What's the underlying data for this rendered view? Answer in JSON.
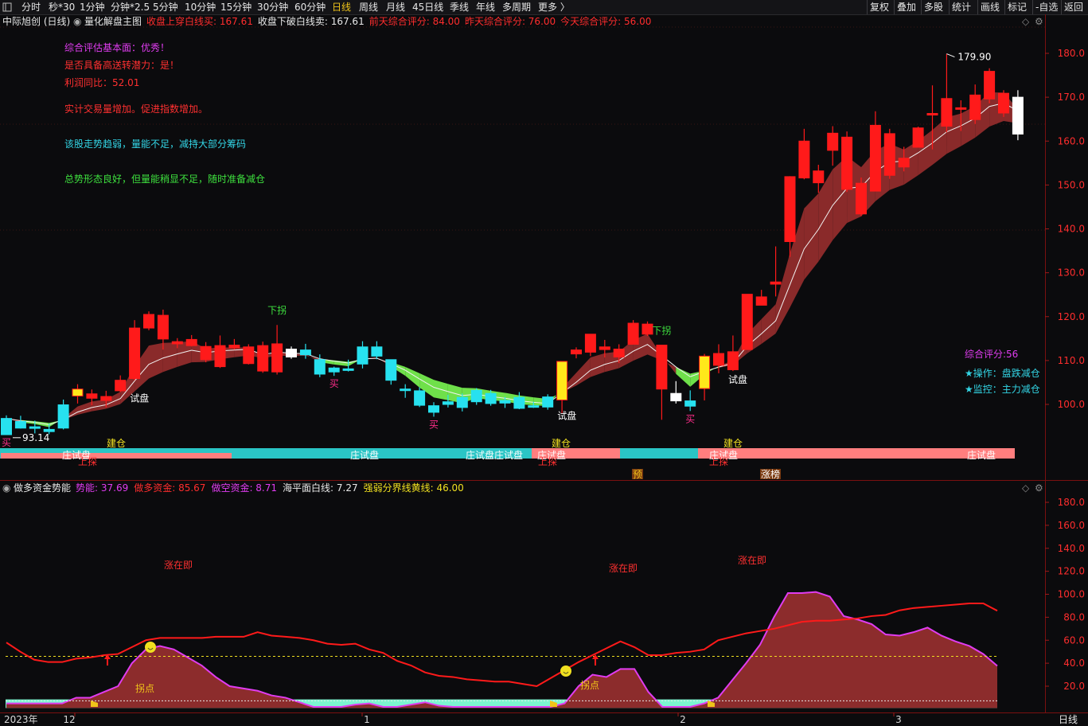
{
  "toolbar": {
    "periods": [
      "分时",
      "秒*30",
      "1分钟",
      "分钟*2.5",
      "5分钟",
      "10分钟",
      "15分钟",
      "30分钟",
      "60分钟",
      "日线",
      "周线",
      "月线",
      "45日线",
      "季线",
      "年线",
      "多周期",
      "更多 〉"
    ],
    "active": "日线",
    "right": [
      "复权",
      "叠加",
      "多股",
      "统计",
      "画线",
      "标记",
      "-自选",
      "返回"
    ]
  },
  "main_header": {
    "stock": "中际旭创 (日线)",
    "indicator": "量化解盘主图",
    "items": [
      {
        "label": "收盘上穿白线买:",
        "value": "167.61",
        "color": "#ff2d2d"
      },
      {
        "label": "收盘下破白线卖:",
        "value": "167.61",
        "color": "#e8e8e8"
      },
      {
        "label": "前天综合评分:",
        "value": "84.00",
        "color": "#ff2d2d"
      },
      {
        "label": "昨天综合评分:",
        "value": "76.00",
        "color": "#ff2d2d"
      },
      {
        "label": "今天综合评分:",
        "value": "56.00",
        "color": "#ff2d2d"
      }
    ]
  },
  "notes": [
    {
      "text": "综合评估基本面：优秀！",
      "color": "#e03cf0"
    },
    {
      "text": "是否具备高送转潜力：是！",
      "color": "#ff3030"
    },
    {
      "text": "利润同比：52.01",
      "color": "#ff3030"
    },
    {
      "text": "实计交易量增加。促进指数增加。",
      "color": "#ff3030"
    },
    {
      "text": "该股走势趋弱，量能不足，减持大部分筹码",
      "color": "#33d6e6"
    },
    {
      "text": "总势形态良好，但量能稍显不足，随时准备减仓",
      "color": "#3ee03e"
    }
  ],
  "right_notes": [
    {
      "text": "综合评分:56",
      "color": "#e03cf0"
    },
    {
      "text": "★操作：盘跌减仓",
      "color": "#33d6e6"
    },
    {
      "text": "★监控：主力减仓",
      "color": "#33d6e6"
    }
  ],
  "chart_data": [
    {
      "type": "candlestick",
      "title": "量化解盘主图",
      "y_ticks": [
        100.0,
        110.0,
        120.0,
        130.0,
        140.0,
        150.0,
        160.0,
        170.0,
        180.0
      ],
      "ylim": [
        88,
        186
      ],
      "high_label": "179.90",
      "low_label": "93.14",
      "candles": [
        {
          "o": 93.1,
          "h": 97.5,
          "l": 93.1,
          "c": 96.8,
          "color": "cyan"
        },
        {
          "o": 96.1,
          "h": 97.4,
          "l": 94.5,
          "c": 94.6,
          "color": "cyan"
        },
        {
          "o": 94.8,
          "h": 96.3,
          "l": 93.4,
          "c": 94.9,
          "color": "cyan"
        },
        {
          "o": 94.3,
          "h": 95.6,
          "l": 93.2,
          "c": 93.8,
          "color": "cyan"
        },
        {
          "o": 94.6,
          "h": 101.1,
          "l": 94.3,
          "c": 99.9,
          "color": "cyan"
        },
        {
          "o": 101.9,
          "h": 104.6,
          "l": 100.2,
          "c": 103.5,
          "color": "yellow"
        },
        {
          "o": 101.4,
          "h": 103.4,
          "l": 99.8,
          "c": 102.4,
          "color": "red"
        },
        {
          "o": 100.9,
          "h": 103.1,
          "l": 99.3,
          "c": 101.8,
          "color": "red"
        },
        {
          "o": 103.1,
          "h": 106.6,
          "l": 102.8,
          "c": 105.5,
          "color": "red"
        },
        {
          "o": 105.9,
          "h": 119.2,
          "l": 105.5,
          "c": 117.4,
          "color": "red"
        },
        {
          "o": 117.4,
          "h": 121.2,
          "l": 116.9,
          "c": 120.5,
          "color": "red"
        },
        {
          "o": 120.3,
          "h": 121.6,
          "l": 112.5,
          "c": 114.9,
          "color": "red"
        },
        {
          "o": 113.8,
          "h": 115.1,
          "l": 112.8,
          "c": 114.3,
          "color": "red"
        },
        {
          "o": 113.4,
          "h": 115.8,
          "l": 113.2,
          "c": 114.8,
          "color": "red"
        },
        {
          "o": 113.2,
          "h": 114.2,
          "l": 109.6,
          "c": 110.2,
          "color": "red"
        },
        {
          "o": 108.6,
          "h": 115.7,
          "l": 108.3,
          "c": 113.4,
          "color": "red"
        },
        {
          "o": 113.5,
          "h": 114.9,
          "l": 112.5,
          "c": 112.9,
          "color": "red"
        },
        {
          "o": 109.3,
          "h": 113.7,
          "l": 109.1,
          "c": 113.1,
          "color": "red"
        },
        {
          "o": 113.4,
          "h": 114.3,
          "l": 107.2,
          "c": 107.6,
          "color": "red"
        },
        {
          "o": 107.4,
          "h": 118.1,
          "l": 106.8,
          "c": 113.8,
          "color": "red"
        },
        {
          "o": 112.6,
          "h": 113.2,
          "l": 110.4,
          "c": 110.8,
          "color": "white"
        },
        {
          "o": 112.4,
          "h": 113.8,
          "l": 110.4,
          "c": 111.3,
          "color": "cyan"
        },
        {
          "o": 110.2,
          "h": 111.4,
          "l": 106.2,
          "c": 106.9,
          "color": "cyan"
        },
        {
          "o": 107.4,
          "h": 108.6,
          "l": 106.5,
          "c": 108.3,
          "color": "cyan"
        },
        {
          "o": 108.1,
          "h": 110.2,
          "l": 107.5,
          "c": 108.1,
          "color": "cyan"
        },
        {
          "o": 109.2,
          "h": 114.4,
          "l": 108.2,
          "c": 113.1,
          "color": "cyan"
        },
        {
          "o": 113.1,
          "h": 114.4,
          "l": 110.3,
          "c": 111.0,
          "color": "cyan"
        },
        {
          "o": 110.2,
          "h": 110.2,
          "l": 104.5,
          "c": 105.5,
          "color": "cyan"
        },
        {
          "o": 103.5,
          "h": 104.6,
          "l": 101.5,
          "c": 103.4,
          "color": "cyan"
        },
        {
          "o": 103.1,
          "h": 103.9,
          "l": 99.4,
          "c": 99.8,
          "color": "cyan"
        },
        {
          "o": 99.7,
          "h": 100.5,
          "l": 97.2,
          "c": 98.2,
          "color": "cyan"
        },
        {
          "o": 100.6,
          "h": 102.2,
          "l": 99.3,
          "c": 100.0,
          "color": "cyan"
        },
        {
          "o": 101.6,
          "h": 102.5,
          "l": 98.4,
          "c": 99.3,
          "color": "cyan"
        },
        {
          "o": 100.6,
          "h": 103.7,
          "l": 99.9,
          "c": 103.2,
          "color": "cyan"
        },
        {
          "o": 102.5,
          "h": 103.3,
          "l": 99.7,
          "c": 100.2,
          "color": "cyan"
        },
        {
          "o": 100.9,
          "h": 101.7,
          "l": 99.2,
          "c": 100.3,
          "color": "cyan"
        },
        {
          "o": 101.6,
          "h": 102.8,
          "l": 98.9,
          "c": 99.1,
          "color": "cyan"
        },
        {
          "o": 99.7,
          "h": 100.6,
          "l": 99.2,
          "c": 99.4,
          "color": "cyan"
        },
        {
          "o": 101.7,
          "h": 102.3,
          "l": 98.8,
          "c": 99.4,
          "color": "cyan"
        },
        {
          "o": 101.0,
          "h": 109.8,
          "l": 97.9,
          "c": 109.8,
          "color": "yellow"
        },
        {
          "o": 111.5,
          "h": 113.0,
          "l": 110.5,
          "c": 112.4,
          "color": "red"
        },
        {
          "o": 111.9,
          "h": 116.0,
          "l": 111.0,
          "c": 116.0,
          "color": "red"
        },
        {
          "o": 112.5,
          "h": 114.7,
          "l": 110.7,
          "c": 113.1,
          "color": "red"
        },
        {
          "o": 110.8,
          "h": 113.7,
          "l": 109.4,
          "c": 112.6,
          "color": "red"
        },
        {
          "o": 113.7,
          "h": 119.2,
          "l": 113.7,
          "c": 118.5,
          "color": "red"
        },
        {
          "o": 116.0,
          "h": 118.9,
          "l": 115.6,
          "c": 118.3,
          "color": "red"
        },
        {
          "o": 113.5,
          "h": 113.5,
          "l": 96.5,
          "c": 103.5,
          "color": "red"
        },
        {
          "o": 102.5,
          "h": 105.3,
          "l": 100.2,
          "c": 100.8,
          "color": "white"
        },
        {
          "o": 100.8,
          "h": 103.2,
          "l": 98.5,
          "c": 99.6,
          "color": "cyan"
        },
        {
          "o": 103.6,
          "h": 111.5,
          "l": 100.9,
          "c": 111.0,
          "color": "yellow"
        },
        {
          "o": 108.9,
          "h": 113.7,
          "l": 107.1,
          "c": 111.6,
          "color": "red"
        },
        {
          "o": 107.9,
          "h": 115.7,
          "l": 107.6,
          "c": 112.0,
          "color": "red"
        },
        {
          "o": 112.5,
          "h": 125.1,
          "l": 112.5,
          "c": 125.1,
          "color": "red"
        },
        {
          "o": 122.6,
          "h": 126.1,
          "l": 122.6,
          "c": 124.5,
          "color": "red"
        },
        {
          "o": 127.4,
          "h": 136.0,
          "l": 124.6,
          "c": 127.9,
          "color": "red"
        },
        {
          "o": 137.1,
          "h": 152.0,
          "l": 133.6,
          "c": 151.9,
          "color": "red"
        },
        {
          "o": 151.6,
          "h": 162.8,
          "l": 151.3,
          "c": 160.0,
          "color": "red"
        },
        {
          "o": 150.5,
          "h": 154.6,
          "l": 148.2,
          "c": 153.2,
          "color": "red"
        },
        {
          "o": 157.9,
          "h": 163.4,
          "l": 154.4,
          "c": 161.8,
          "color": "red"
        },
        {
          "o": 149.0,
          "h": 162.2,
          "l": 148.4,
          "c": 160.9,
          "color": "red"
        },
        {
          "o": 143.4,
          "h": 151.7,
          "l": 142.9,
          "c": 150.4,
          "color": "red"
        },
        {
          "o": 148.6,
          "h": 166.8,
          "l": 148.6,
          "c": 163.6,
          "color": "red"
        },
        {
          "o": 152.2,
          "h": 162.8,
          "l": 151.4,
          "c": 161.7,
          "color": "red"
        },
        {
          "o": 154.1,
          "h": 158.7,
          "l": 153.1,
          "c": 156.1,
          "color": "red"
        },
        {
          "o": 158.6,
          "h": 163.3,
          "l": 158.6,
          "c": 163.0,
          "color": "red"
        },
        {
          "o": 166.3,
          "h": 172.7,
          "l": 158.1,
          "c": 166.3,
          "color": "red"
        },
        {
          "o": 163.4,
          "h": 179.9,
          "l": 162.0,
          "c": 169.7,
          "color": "red"
        },
        {
          "o": 167.3,
          "h": 169.3,
          "l": 162.3,
          "c": 167.6,
          "color": "red"
        },
        {
          "o": 164.9,
          "h": 172.9,
          "l": 163.9,
          "c": 170.5,
          "color": "red"
        },
        {
          "o": 169.6,
          "h": 176.6,
          "l": 168.6,
          "c": 175.9,
          "color": "red"
        },
        {
          "o": 166.4,
          "h": 171.6,
          "l": 165.5,
          "c": 170.9,
          "color": "red"
        },
        {
          "o": 170.0,
          "h": 171.6,
          "l": 160.2,
          "c": 161.6,
          "color": "white"
        }
      ],
      "signals": [
        {
          "i": 0,
          "text": "买",
          "color": "#ff2d8a"
        },
        {
          "i": 8,
          "text": "试盘",
          "color": "#ffffff"
        },
        {
          "i": 19,
          "text": "下拐",
          "color": "#3ee03e"
        },
        {
          "i": 23,
          "text": "买",
          "color": "#ff2d8a"
        },
        {
          "i": 30,
          "text": "买",
          "color": "#ff2d8a"
        },
        {
          "i": 38,
          "text": "试盘",
          "color": "#ffffff"
        },
        {
          "i": 46,
          "text": "下拐",
          "color": "#3ee03e"
        },
        {
          "i": 48,
          "text": "买",
          "color": "#ff2d8a"
        },
        {
          "i": 50,
          "text": "试盘",
          "color": "#ffffff"
        }
      ],
      "band_labels": [
        {
          "text": "建仓",
          "color": "#f0e020"
        },
        {
          "text": "庄试盘",
          "color": "#ffffff"
        },
        {
          "text": "上探",
          "color": "#ff3030"
        },
        {
          "text": "庄试盘",
          "color": "#ffffff"
        },
        {
          "text": "庄试盘庄试盘",
          "color": "#ffffff"
        },
        {
          "text": "建仓",
          "color": "#f0e020"
        },
        {
          "text": "庄试盘",
          "color": "#ffffff"
        },
        {
          "text": "上探",
          "color": "#ff3030"
        },
        {
          "text": "建仓",
          "color": "#f0e020"
        },
        {
          "text": "庄试盘",
          "color": "#ffffff"
        },
        {
          "text": "上探",
          "color": "#ff3030"
        },
        {
          "text": "庄试盘",
          "color": "#ffffff"
        },
        {
          "text": "预",
          "color": "#f0c419"
        },
        {
          "text": "涨榜",
          "color": "#ffffff"
        }
      ]
    },
    {
      "type": "area",
      "title": "做多资金势能",
      "y_ticks": [
        20.0,
        40.0,
        60.0,
        80.0,
        100.0,
        120.0,
        140.0,
        160.0,
        180.0
      ],
      "ylim": [
        5,
        192
      ],
      "legend": [
        {
          "label": "势能:",
          "value": "37.69",
          "color": "#e03cf0"
        },
        {
          "label": "做多资金:",
          "value": "85.67",
          "color": "#ff2d2d"
        },
        {
          "label": "做空资金:",
          "value": "8.71",
          "color": "#e03cf0"
        },
        {
          "label": "海平面白线:",
          "value": "7.27",
          "color": "#e8e8e8"
        },
        {
          "label": "强弱分界线黄线:",
          "value": "46.00",
          "color": "#f0e020"
        }
      ],
      "yellow_line": 46.0,
      "white_line": 7.27,
      "momentum": [
        5,
        5,
        5,
        5,
        5,
        10,
        10,
        15,
        20,
        40,
        52,
        55,
        52,
        45,
        38,
        28,
        20,
        18,
        16,
        12,
        10,
        6,
        2,
        2,
        2,
        4,
        5,
        2,
        2,
        4,
        6,
        3,
        2,
        2,
        2,
        2,
        2,
        2,
        2,
        2,
        5,
        20,
        30,
        28,
        35,
        35,
        15,
        2,
        2,
        2,
        5,
        10,
        25,
        40,
        56,
        80,
        101,
        101,
        102,
        98,
        81,
        78,
        74,
        65,
        64,
        67,
        71,
        64,
        59,
        55,
        48,
        37.69
      ],
      "bull": [
        58,
        50,
        43,
        41,
        41,
        44,
        45,
        47,
        48,
        54,
        60,
        62,
        62,
        62,
        62,
        63,
        63,
        63,
        67,
        64,
        63,
        62,
        60,
        57,
        56,
        57,
        52,
        49,
        42,
        38,
        32,
        29,
        28,
        26,
        25,
        24,
        24,
        22,
        20,
        27,
        34,
        41,
        47,
        53,
        59,
        54,
        47,
        47,
        49,
        50,
        52,
        60,
        63,
        66,
        68,
        70,
        73,
        76,
        77,
        77,
        78,
        79,
        81,
        82,
        86,
        88,
        89,
        90,
        91,
        92,
        92,
        85.67
      ],
      "annotations": [
        {
          "text": "涨在即",
          "color": "#ff3030"
        },
        {
          "text": "拐点",
          "color": "#f0c419"
        },
        {
          "text": "涨在即",
          "color": "#ff3030"
        },
        {
          "text": "拐点",
          "color": "#f0c419"
        },
        {
          "text": "涨在即",
          "color": "#ff3030"
        }
      ],
      "x_labels": [
        "2023年",
        "12",
        "1",
        "2",
        "3"
      ],
      "period_label": "日线"
    }
  ]
}
